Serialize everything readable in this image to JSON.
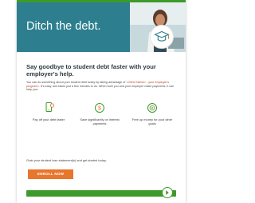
{
  "hero": {
    "title": "Ditch the debt."
  },
  "headline": "Say goodbye to student debt faster with your employer's help.",
  "intro": {
    "part1": "You can do something about your student debt today by taking advantage of ",
    "placeholder": "<Client Name> - your employer's program>",
    "part2": ". It's easy, and takes just a few minutes to do. When both you and your employer make payments, it can help you:"
  },
  "benefits": [
    {
      "icon": "phone-payment-icon",
      "label": "Pay off your debt faster"
    },
    {
      "icon": "money-savings-icon",
      "label": "Save significantly on interest payments"
    },
    {
      "icon": "target-goals-icon",
      "label": "Free up money for your other goals"
    }
  ],
  "grab_text": "Grab your student loan statement(s) and get started today.",
  "enroll_label": "ENROLL NOW",
  "colors": {
    "brand_green": "#3e9a2a",
    "hero_teal": "#2d7f8f",
    "cta_orange": "#e8762d",
    "placeholder_red": "#c0392b"
  }
}
